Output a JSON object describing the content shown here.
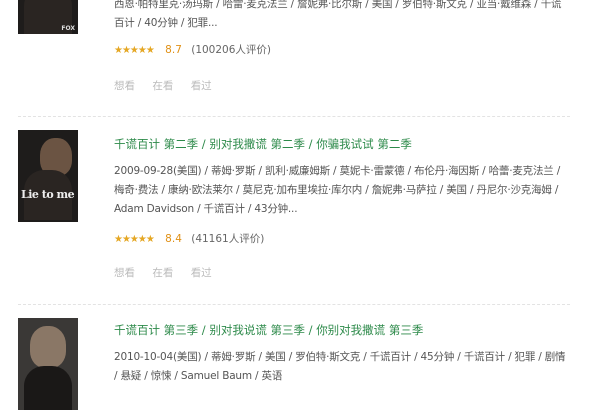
{
  "entries": [
    {
      "poster_text": "",
      "poster_logo": "FOX",
      "titles": [],
      "meta": "西恩·帕特里克·汤玛斯 / 哈雷·麦克法兰 / 詹妮弗·比尔斯 / 美国 / 罗伯特·斯文克 / 亚当·戴维森 / 千谎百计 / 40分钟 / 犯罪...",
      "stars": "★★★★★",
      "score": "8.7",
      "votes": "(100206人评价)",
      "actions": [
        "想看",
        "在看",
        "看过"
      ]
    },
    {
      "poster_text": "Lie to me",
      "poster_logo": "",
      "titles": [
        "千谎百计 第二季",
        "别对我撒谎 第二季",
        "你骗我试试 第二季"
      ],
      "meta": "2009-09-28(美国) / 蒂姆·罗斯 / 凯利·威廉姆斯 / 莫妮卡·雷蒙德 / 布伦丹·海因斯 / 哈蕾·麦克法兰 / 梅奇·费法 / 康纳·欧法莱尔 / 莫尼克·加布里埃拉·库尔内 / 詹妮弗·马萨拉 / 美国 / 丹尼尔·沙克海姆 / Adam Davidson / 千谎百计 / 43分钟...",
      "stars": "★★★★★",
      "score": "8.4",
      "votes": "(41161人评价)",
      "actions": [
        "想看",
        "在看",
        "看过"
      ]
    },
    {
      "poster_text": "",
      "poster_logo": "",
      "titles": [
        "千谎百计 第三季",
        "别对我说谎 第三季",
        "你别对我撒谎 第三季"
      ],
      "meta": "2010-10-04(美国) / 蒂姆·罗斯 / 美国 / 罗伯特·斯文克 / 千谎百计 / 45分钟 / 千谎百计 / 犯罪 / 剧情 / 悬疑 / 惊悚 / Samuel Baum / 英语",
      "stars": "",
      "score": "",
      "votes": "",
      "actions": []
    }
  ],
  "title_separator": " / ",
  "colors": {
    "link": "#2d8a4a",
    "star": "#e5a724",
    "score": "#e09015"
  }
}
